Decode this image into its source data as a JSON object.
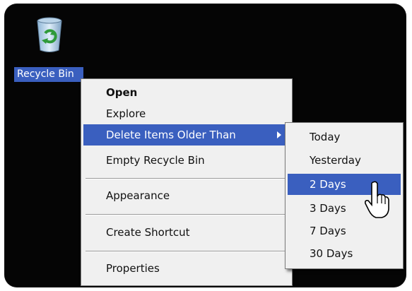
{
  "desktop": {
    "icon_label": "Recycle Bin",
    "icon_name": "recycle-bin-icon"
  },
  "context_menu": {
    "items": [
      {
        "label": "Open",
        "bold": true
      },
      {
        "label": "Explore"
      },
      {
        "label": "Delete Items Older Than",
        "highlighted": true,
        "has_submenu": true
      },
      {
        "label": "Empty Recycle Bin"
      },
      {
        "label": "Appearance"
      },
      {
        "label": "Create Shortcut"
      },
      {
        "label": "Properties"
      }
    ]
  },
  "submenu": {
    "items": [
      {
        "label": "Today"
      },
      {
        "label": "Yesterday"
      },
      {
        "label": "2 Days",
        "highlighted": true
      },
      {
        "label": "3 Days"
      },
      {
        "label": "7 Days"
      },
      {
        "label": "30 Days"
      }
    ]
  },
  "colors": {
    "highlight": "#3a5fbf",
    "menu_bg": "#f0f0f0",
    "desktop_bg": "#050505"
  },
  "icons": [
    "recycle-bin-icon",
    "submenu-arrow-icon",
    "mouse-cursor-icon"
  ]
}
